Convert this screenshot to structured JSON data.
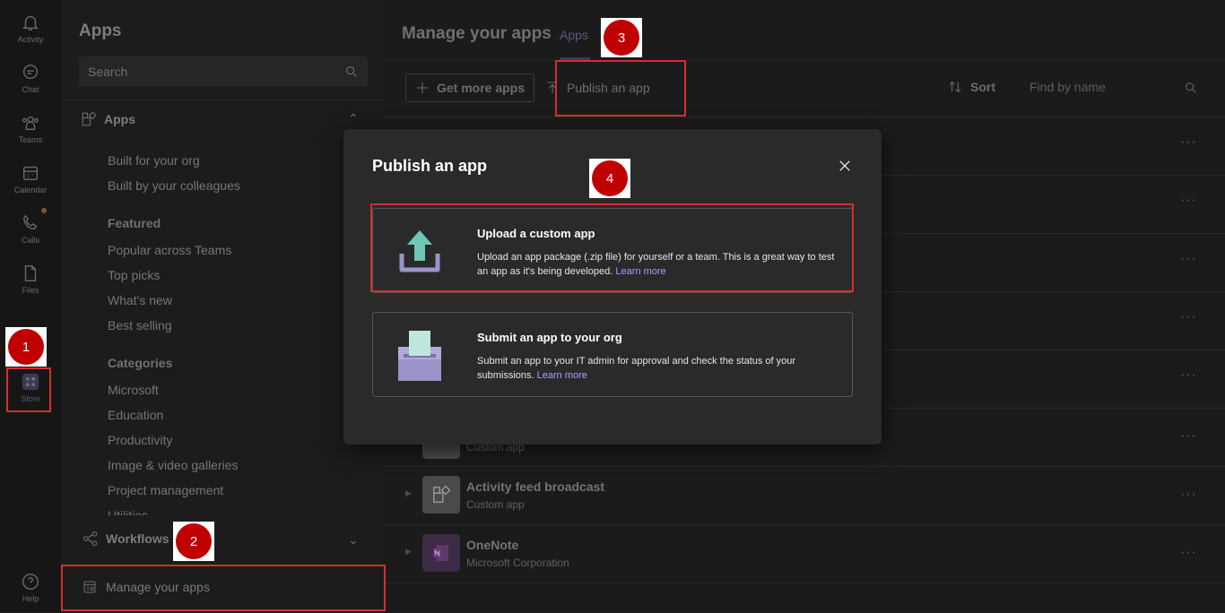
{
  "rail": {
    "items": [
      {
        "label": "Activity",
        "icon": "bell-icon"
      },
      {
        "label": "Chat",
        "icon": "chat-icon"
      },
      {
        "label": "Teams",
        "icon": "teams-icon"
      },
      {
        "label": "Calendar",
        "icon": "calendar-icon"
      },
      {
        "label": "Calls",
        "icon": "phone-icon"
      },
      {
        "label": "Files",
        "icon": "file-icon"
      },
      {
        "label": "Store",
        "icon": "store-icon"
      },
      {
        "label": "Help",
        "icon": "help-icon"
      }
    ]
  },
  "sidebar": {
    "title": "Apps",
    "search_placeholder": "Search",
    "apps_section": "Apps",
    "apps_links": [
      "Built for your org",
      "Built by your colleagues"
    ],
    "featured_heading": "Featured",
    "featured_links": [
      "Popular across Teams",
      "Top picks",
      "What's new",
      "Best selling"
    ],
    "categories_heading": "Categories",
    "category_links": [
      "Microsoft",
      "Education",
      "Productivity",
      "Image & video galleries",
      "Project management",
      "Utilities"
    ],
    "workflows_section": "Workflows",
    "manage_label": "Manage your apps"
  },
  "main": {
    "title": "Manage your apps",
    "tab": "Apps",
    "get_more_label": "Get more apps",
    "publish_label": "Publish an app",
    "sort_label": "Sort",
    "find_placeholder": "Find by name",
    "rows": [
      {
        "name": "",
        "sub": "Custom app"
      },
      {
        "name": "Activity feed broadcast",
        "sub": "Custom app"
      },
      {
        "name": "OneNote",
        "sub": "Microsoft Corporation"
      }
    ]
  },
  "modal": {
    "title": "Publish an app",
    "options": [
      {
        "title": "Upload a custom app",
        "desc": "Upload an app package (.zip file) for yourself or a team. This is a great way to test an app as it's being developed.",
        "link": "Learn more"
      },
      {
        "title": "Submit an app to your org",
        "desc": "Submit an app to your IT admin for approval and check the status of your submissions.",
        "link": "Learn more"
      }
    ]
  },
  "annotations": {
    "badges": [
      "1",
      "2",
      "3",
      "4"
    ],
    "color": "#c00000"
  },
  "colors": {
    "accent": "#9ea2ff",
    "upload_arrow": "#6fc7b5",
    "tray": "#9a94c8"
  }
}
